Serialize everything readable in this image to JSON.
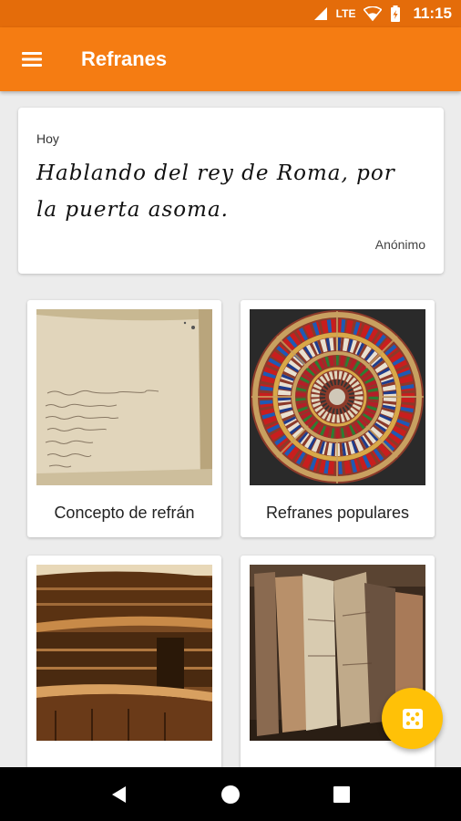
{
  "status_bar": {
    "network": "LTE",
    "time": "11:15"
  },
  "app_bar": {
    "title": "Refranes",
    "menu_icon": "hamburger-menu-icon"
  },
  "quote_card": {
    "label": "Hoy",
    "text": "Hablando del rey de Roma, por la puerta asoma.",
    "author": "Anónimo"
  },
  "categories": [
    {
      "label": "Concepto de refrán",
      "icon": "old-manuscript-image"
    },
    {
      "label": "Refranes populares",
      "icon": "circular-bookshelf-image"
    },
    {
      "label": "",
      "icon": "library-shelves-image"
    },
    {
      "label": "",
      "icon": "old-books-image"
    }
  ],
  "fab": {
    "icon": "dice-icon",
    "color": "#FFC107"
  },
  "nav_bar": {
    "back_icon": "back-triangle-icon",
    "home_icon": "home-circle-icon",
    "recents_icon": "recents-square-icon"
  },
  "colors": {
    "primary": "#F57C12",
    "primary_dark": "#E46C0A",
    "accent": "#FFC107"
  }
}
